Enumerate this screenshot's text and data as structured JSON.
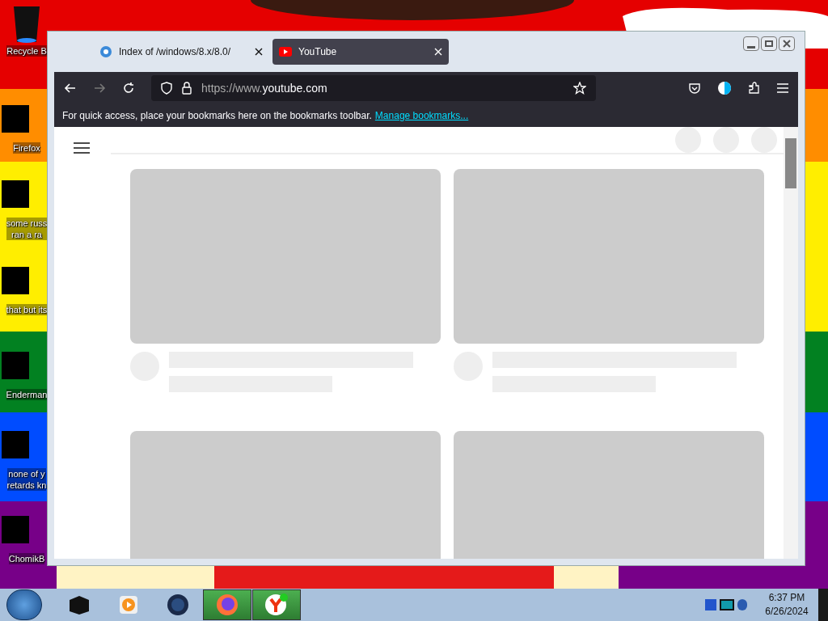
{
  "desktop_icons": [
    {
      "lines": [
        "Recycle B"
      ],
      "kind": "bin"
    },
    {
      "lines": [
        "Firefox"
      ],
      "kind": "redacted"
    },
    {
      "lines": [
        "some russ",
        "ran a ra"
      ],
      "kind": "redacted"
    },
    {
      "lines": [
        "that but its"
      ],
      "kind": "redacted"
    },
    {
      "lines": [
        "Enderman"
      ],
      "kind": "redacted"
    },
    {
      "lines": [
        "none of y",
        "retards kn"
      ],
      "kind": "redacted"
    },
    {
      "lines": [
        "ChomikB"
      ],
      "kind": "redacted"
    }
  ],
  "browser": {
    "tabs": [
      {
        "title": "Index of /windows/8.x/8.0/",
        "selected": false,
        "kind": "ie"
      },
      {
        "title": "YouTube",
        "selected": true,
        "kind": "youtube"
      }
    ],
    "url_dim": "https://www.",
    "url_host": "youtube.com",
    "bookmarks_hint": "For quick access, place your bookmarks here on the bookmarks toolbar.",
    "bookmarks_link": "Manage bookmarks...",
    "video_cards": [
      {
        "kind": "full"
      },
      {
        "kind": "full"
      },
      {
        "kind": "cut"
      },
      {
        "kind": "cut"
      }
    ]
  },
  "taskbar": {
    "items": [
      {
        "kind": "box",
        "running": false
      },
      {
        "kind": "player",
        "running": false
      },
      {
        "kind": "globe",
        "running": false
      },
      {
        "kind": "firefox",
        "running": true
      },
      {
        "kind": "yandex",
        "running": true
      }
    ],
    "time": "6:37 PM",
    "date": "6/26/2024"
  }
}
